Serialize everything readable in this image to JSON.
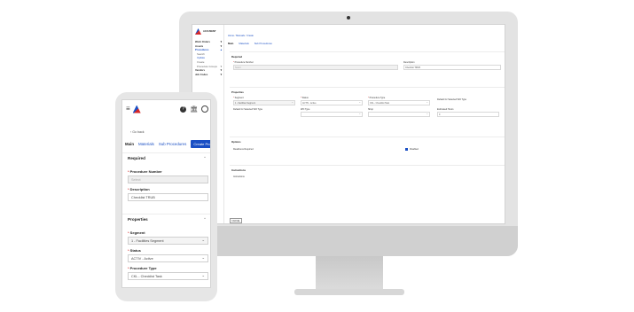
{
  "desktop": {
    "brand": "ACCUSENT",
    "nav": [
      {
        "label": "Work Orders",
        "kind": "main"
      },
      {
        "label": "Assets",
        "kind": "main"
      },
      {
        "label": "Procedures",
        "kind": "main"
      },
      {
        "label": "Search",
        "kind": "sub"
      },
      {
        "label": "Update",
        "kind": "sub"
      },
      {
        "label": "Create",
        "kind": "sub"
      },
      {
        "label": "Procedure Groups",
        "kind": "sub"
      },
      {
        "label": "Vendors",
        "kind": "main"
      },
      {
        "label": "Job Codes",
        "kind": "main"
      }
    ],
    "breadcrumb": [
      "Home",
      "Manuals",
      "Create"
    ],
    "tabs": [
      "Main",
      "Materials",
      "Sub Procedures"
    ],
    "required_title": "Required",
    "procedure_number_label": "Procedure Number",
    "procedure_number_value": "Select",
    "description_label": "Description",
    "description_value": "Checklist TRUB",
    "properties_title": "Properties",
    "segment_label": "Segment",
    "segment_value": "1 - Facilities Segment",
    "status_label": "Status",
    "status_value": "ACTIV - Active",
    "procedure_type_label": "Procedure Type",
    "procedure_type_value": "CKL - Checklist Task",
    "default_note": "Default for Selected WO Type",
    "wo_type_label": "WO Type",
    "shop_label": "Shop",
    "est_hours_label": "Estimated Hours",
    "est_hours_value": "0",
    "options_title": "Options",
    "readiness_label": "Readiness Required",
    "disabled_label": "Disabled",
    "instructions_title": "Instructions",
    "instructions_value": "Instructions",
    "cancel_label": "CANCEL"
  },
  "mobile": {
    "back_label": "Go back",
    "tabs": [
      "Main",
      "Materials",
      "Sub Procedures"
    ],
    "pill_label": "Create Procedure",
    "required_title": "Required",
    "procedure_number_label": "Procedure Number",
    "procedure_number_value": "Select",
    "description_label": "Description",
    "description_value": "Checklist TRUB",
    "properties_title": "Properties",
    "segment_label": "Segment",
    "segment_value": "1 - Facilities Segment",
    "status_label": "Status",
    "status_value": "ACTIV - Active",
    "procedure_type_label": "Procedure Type",
    "procedure_type_value": "CKL - Checklist Task"
  },
  "colors": {
    "accent": "#1a4fc4",
    "required": "#d62828"
  }
}
